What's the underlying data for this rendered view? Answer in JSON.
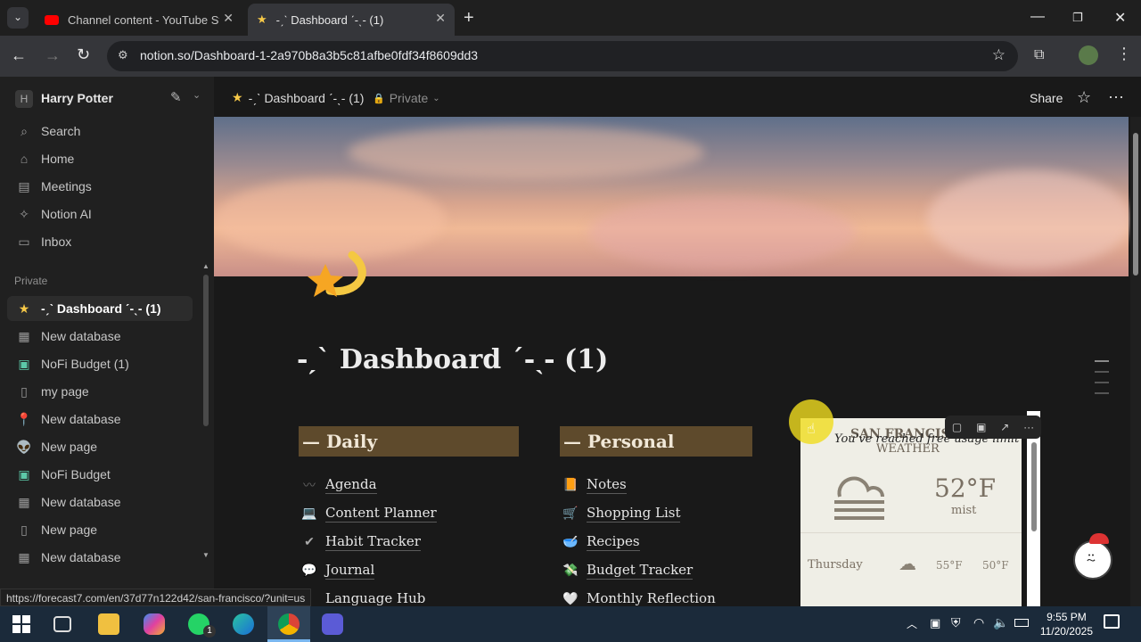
{
  "browser": {
    "tabs": [
      {
        "title": "Channel content - YouTube Stu",
        "active": false
      },
      {
        "title": "-ˏˋ Dashboard ˊ-ˎ- (1)",
        "active": true
      }
    ],
    "url": "notion.so/Dashboard-1-2a970b8a3b5c81afbe0fdf34f8609dd3",
    "status_url": "https://forecast7.com/en/37d77n122d42/san-francisco/?unit=us"
  },
  "sidebar": {
    "workspace_initial": "H",
    "workspace_name": "Harry Potter",
    "nav": [
      {
        "label": "Search",
        "icon": "search-icon"
      },
      {
        "label": "Home",
        "icon": "home-icon"
      },
      {
        "label": "Meetings",
        "icon": "meetings-icon"
      },
      {
        "label": "Notion AI",
        "icon": "ai-icon"
      },
      {
        "label": "Inbox",
        "icon": "inbox-icon"
      }
    ],
    "section_label": "Private",
    "pages": [
      {
        "label": "-ˏˋ Dashboard ˊ-ˎ- (1)",
        "icon": "shooting-star-icon",
        "active": true
      },
      {
        "label": "New database",
        "icon": "table-icon"
      },
      {
        "label": "NoFi Budget (1)",
        "icon": "budget-icon"
      },
      {
        "label": "my page",
        "icon": "document-icon"
      },
      {
        "label": "New database",
        "icon": "pin-icon"
      },
      {
        "label": "New page",
        "icon": "alien-icon"
      },
      {
        "label": "NoFi Budget",
        "icon": "budget-icon"
      },
      {
        "label": "New database",
        "icon": "table-icon"
      },
      {
        "label": "New page",
        "icon": "document-icon"
      },
      {
        "label": "New database",
        "icon": "table-icon"
      }
    ]
  },
  "topbar": {
    "breadcrumb": "-ˏˋ Dashboard ˊ-ˎ- (1)",
    "privacy": "Private",
    "share_label": "Share"
  },
  "page": {
    "title": "-ˏˋ Dashboard ˊ-ˎ- (1)",
    "columns": [
      {
        "heading": "— Daily",
        "items": [
          {
            "label": "Agenda",
            "emoji": "〰"
          },
          {
            "label": "Content Planner",
            "emoji": "💻"
          },
          {
            "label": "Habit Tracker",
            "emoji": "✔"
          },
          {
            "label": "Journal",
            "emoji": "💬"
          },
          {
            "label": "Language Hub",
            "emoji": "▌"
          }
        ]
      },
      {
        "heading": "— Personal",
        "items": [
          {
            "label": "Notes",
            "emoji": "📙"
          },
          {
            "label": "Shopping List",
            "emoji": "🛒"
          },
          {
            "label": "Recipes",
            "emoji": "🥣"
          },
          {
            "label": "Budget Tracker",
            "emoji": "💸"
          },
          {
            "label": "Monthly Reflection",
            "emoji": "🤍"
          }
        ]
      }
    ],
    "weather": {
      "city_title": "SAN FRANCISCO",
      "subtitle": "WEATHER",
      "limit_notice": "You've reached free usage limit :",
      "temperature": "52°F",
      "condition": "mist",
      "forecast": [
        {
          "day": "Thursday",
          "high": "55°F",
          "low": "50°F"
        }
      ]
    }
  },
  "taskbar": {
    "time": "9:55 PM",
    "date": "11/20/2025",
    "whatsapp_badge": "1"
  }
}
